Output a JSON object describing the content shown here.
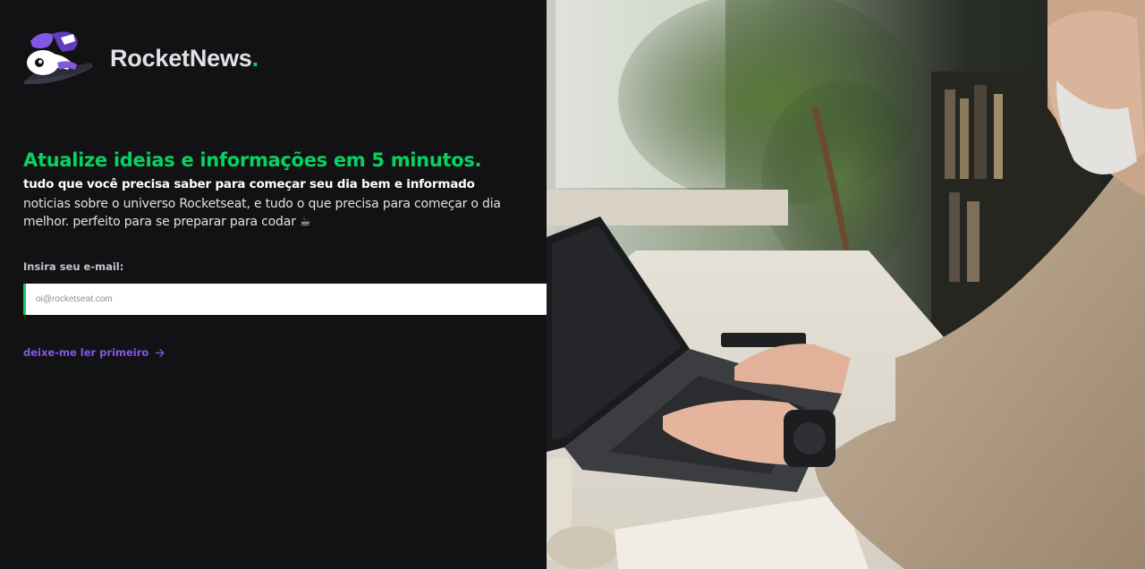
{
  "brand": {
    "name": "RocketNews",
    "dot": ".",
    "logo_icon": "astronaut-laptop-logo-icon"
  },
  "hero": {
    "headline": "Atualize ideias e informações em 5 minutos.",
    "subheadline": "tudo que você precisa saber para começar seu dia bem e informado",
    "description": "noticias sobre o universo Rocketseat, e tudo o que precisa para começar o dia melhor. perfeito para se preparar para codar ☕"
  },
  "form": {
    "email_label": "Insira seu e-mail:",
    "email_placeholder": "oi@rocketseat.com",
    "email_value": "",
    "submit_icon": "send-paper-plane-icon"
  },
  "link": {
    "label": "deixe-me ler primeiro",
    "icon": "arrow-right-icon"
  },
  "image": {
    "description_icon": "photo-man-typing-laptop"
  },
  "colors": {
    "background": "#121214",
    "green": "#04d361",
    "purple": "#8257e5",
    "text": "#e1e1e6"
  }
}
